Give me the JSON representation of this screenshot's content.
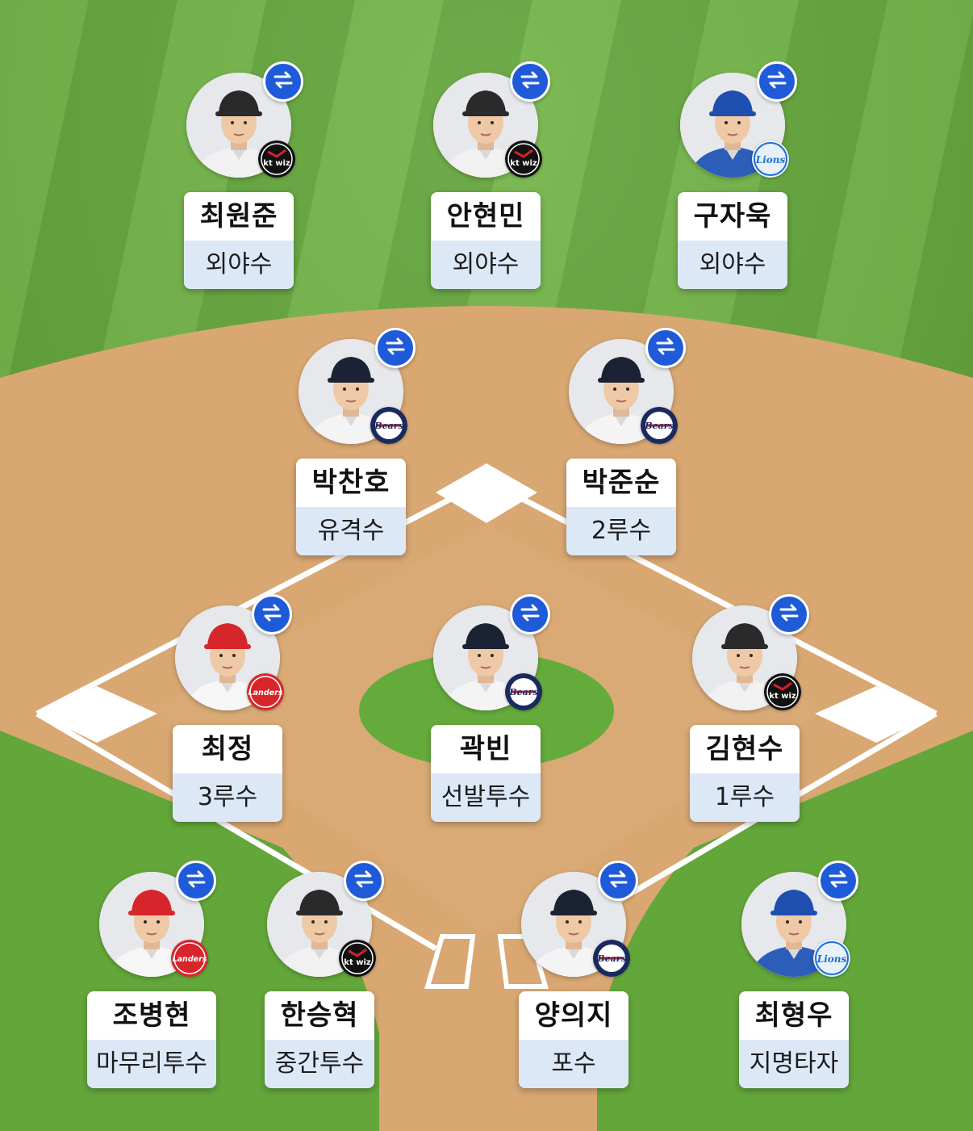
{
  "colors": {
    "grass": "#69ac3f",
    "dirt": "#d8a772",
    "swap_button": "#1f5bd8",
    "position_bg": "#dde8f7"
  },
  "swap_icon": "swap-arrows-icon",
  "players": [
    {
      "name": "최원준",
      "position": "외야수",
      "team": "kt wiz",
      "team_icon": "kt-wiz-logo-icon"
    },
    {
      "name": "안현민",
      "position": "외야수",
      "team": "kt wiz",
      "team_icon": "kt-wiz-logo-icon"
    },
    {
      "name": "구자욱",
      "position": "외야수",
      "team": "Lions",
      "team_icon": "lions-logo-icon"
    },
    {
      "name": "박찬호",
      "position": "유격수",
      "team": "Bears",
      "team_icon": "bears-logo-icon"
    },
    {
      "name": "박준순",
      "position": "2루수",
      "team": "Bears",
      "team_icon": "bears-logo-icon"
    },
    {
      "name": "최정",
      "position": "3루수",
      "team": "Landers",
      "team_icon": "landers-logo-icon"
    },
    {
      "name": "곽빈",
      "position": "선발투수",
      "team": "Bears",
      "team_icon": "bears-logo-icon"
    },
    {
      "name": "김현수",
      "position": "1루수",
      "team": "kt wiz",
      "team_icon": "kt-wiz-logo-icon"
    },
    {
      "name": "조병현",
      "position": "마무리투수",
      "team": "Landers",
      "team_icon": "landers-logo-icon"
    },
    {
      "name": "한승혁",
      "position": "중간투수",
      "team": "kt wiz",
      "team_icon": "kt-wiz-logo-icon"
    },
    {
      "name": "양의지",
      "position": "포수",
      "team": "Bears",
      "team_icon": "bears-logo-icon"
    },
    {
      "name": "최형우",
      "position": "지명타자",
      "team": "Lions",
      "team_icon": "lions-logo-icon"
    }
  ]
}
